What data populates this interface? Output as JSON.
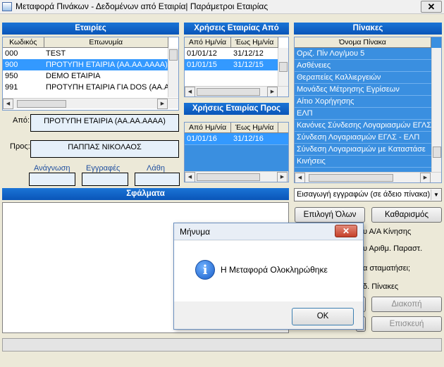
{
  "window": {
    "title": "Μεταφορά Πινάκων - Δεδομένων από Εταιρία| Παράμετροι Εταιρίας",
    "close_label": "✕"
  },
  "companies": {
    "header": "Εταιρίες",
    "columns": [
      "Κωδικός",
      "Επωνυμία"
    ],
    "rows": [
      {
        "code": "000",
        "name": "TEST"
      },
      {
        "code": "900",
        "name": "ΠΡΟΤΥΠΗ  ΕΤΑΙΡΙΑ (ΑΑ.ΑΑ.ΑΑΑΑ)"
      },
      {
        "code": "950",
        "name": "DEMO ΕΤΑΙΡΙΑ"
      },
      {
        "code": "991",
        "name": "ΠΡΟΤΥΠΗ ΕΤΑΙΡΙΑ ΓΙΑ DOS (ΑΑ.ΑΑ"
      }
    ],
    "selected_index": 1
  },
  "years_from": {
    "header": "Χρήσεις Εταιρίας Από",
    "columns": [
      "Από Ημ/νία",
      "Έως Ημ/νία"
    ],
    "rows": [
      {
        "from": "01/01/12",
        "to": "31/12/12"
      },
      {
        "from": "01/01/15",
        "to": "31/12/15"
      }
    ],
    "selected_index": 1
  },
  "years_to": {
    "header": "Χρήσεις Εταιρίας Προς",
    "columns": [
      "Από Ημ/νία",
      "Έως Ημ/νία"
    ],
    "rows": [
      {
        "from": "01/01/16",
        "to": "31/12/16"
      }
    ]
  },
  "tables": {
    "header": "Πίνακες",
    "column": "Όνομα Πίνακα",
    "rows": [
      "Οριζ. Πίν Λογ/μου 5",
      "Ασθένειες",
      "Θεραπείες Καλλιεργειών",
      "Μονάδες Μέτρησης Εγρίσεων",
      "Αίτιο Χορήγησης",
      "ΕΛΠ",
      "Κανόνες Σύνδεσης Λογαριασμών ΕΓΛΣ",
      "Σύνδεση Λογαριασμών ΕΓΛΣ - ΕΛΠ",
      "Σύνδεση Λογαριασμών με Καταστάσε",
      "Κινήσεις"
    ]
  },
  "info": {
    "from_label": "Από:",
    "from_value": "ΠΡΟΤΥΠΗ  ΕΤΑΙΡΙΑ (ΑΑ.ΑΑ.ΑΑΑΑ)",
    "to_label": "Προς:",
    "to_value": "ΠΑΠΠΑΣ ΝΙΚΟΛΑΟΣ",
    "read_label": "Ανάγνωση",
    "write_label": "Εγγραφές",
    "errors_label": "Λάθη"
  },
  "errors_panel": {
    "header": "Σφάλματα"
  },
  "options": {
    "mode_select": "Εισαγωγή εγγραφών (σε άδειο πίνακα)",
    "select_all": "Επιλογή Όλων",
    "clear": "Καθαρισμός",
    "opt1_fragment": "υ Α/Α Κίνησης",
    "opt2_fragment": "υ Αριθμ. Παραστ.",
    "opt3_fragment": "α σταματήσει;",
    "opt4_fragment": "δ.  Πίνακες",
    "stop_button": "Διακοπή",
    "repair_button": "Επισκευή"
  },
  "dialog": {
    "title": "Μήνυμα",
    "message": "Η Μεταφορά Ολοκληρώθηκε",
    "ok": "OK",
    "close_label": "✕",
    "icon_glyph": "i"
  }
}
